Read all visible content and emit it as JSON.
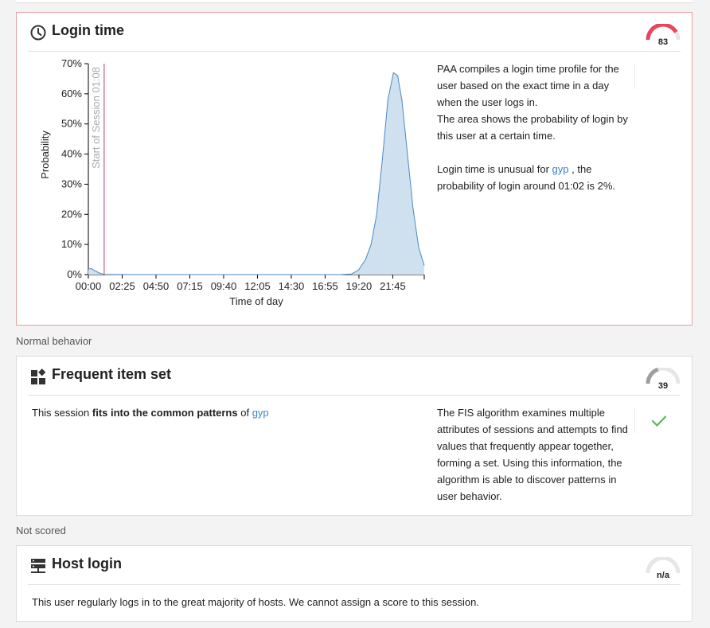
{
  "sections": {
    "normal_behavior": "Normal behavior",
    "not_scored": "Not scored"
  },
  "login_time": {
    "title": "Login time",
    "icon": "clock-icon",
    "score": "83",
    "score_fraction": 0.83,
    "score_color": "#e8455a",
    "description_1": "PAA compiles a login time profile for the user based on the exact time in a day when the user logs in.",
    "description_2": "The area shows the probability of login by this user at a certain time.",
    "unusual_prefix": "Login time is unusual for",
    "user": "gyp",
    "unusual_suffix": ", the probability of login around 01:02 is 2%."
  },
  "chart_data": {
    "type": "area",
    "xlabel": "Time of day",
    "ylabel": "Probability",
    "x_ticks": [
      "00:00",
      "02:25",
      "04:50",
      "07:15",
      "09:40",
      "12:05",
      "14:30",
      "16:55",
      "19:20",
      "21:45"
    ],
    "y_ticks": [
      "0%",
      "10%",
      "20%",
      "30%",
      "40%",
      "50%",
      "60%",
      "70%"
    ],
    "ylim": [
      0,
      70
    ],
    "xlim_hours": [
      0,
      24
    ],
    "series": [
      {
        "x": [
          0,
          0.2,
          0.5,
          0.8,
          1.0,
          1.2,
          3,
          6,
          10,
          14,
          18,
          18.8,
          19.3,
          19.8,
          20.2,
          20.6,
          21.0,
          21.4,
          21.8,
          22.1,
          22.4,
          22.8,
          23.2,
          23.6,
          24.0
        ],
        "y": [
          1.8,
          2.0,
          1.2,
          0.5,
          0.2,
          0.05,
          0,
          0,
          0,
          0,
          0,
          0.2,
          1.5,
          5,
          10,
          20,
          38,
          58,
          67,
          66,
          58,
          40,
          22,
          9,
          3
        ]
      }
    ],
    "annotation": {
      "label": "Start of Session 01:08",
      "x_hours": 1.13
    },
    "colors": {
      "area": "#cfe0ef",
      "line": "#4a88c6",
      "marker": "#b0455a"
    }
  },
  "frequent_item_set": {
    "title": "Frequent item set",
    "icon": "widgets-icon",
    "score": "39",
    "score_fraction": 0.39,
    "score_color": "#9e9e9e",
    "text_prefix": "This session",
    "text_bold": "fits into the common patterns",
    "text_of": "of",
    "user": "gyp",
    "description": "The FIS algorithm examines multiple attributes of sessions and attempts to find values that frequently appear together, forming a set. Using this information, the algorithm is able to discover patterns in user behavior.",
    "status_icon": "check-icon",
    "status_color": "#5cb85c"
  },
  "host_login": {
    "title": "Host login",
    "icon": "server-icon",
    "score": "n/a",
    "text": "This user regularly logs in to the great majority of hosts. We cannot assign a score to this session."
  }
}
